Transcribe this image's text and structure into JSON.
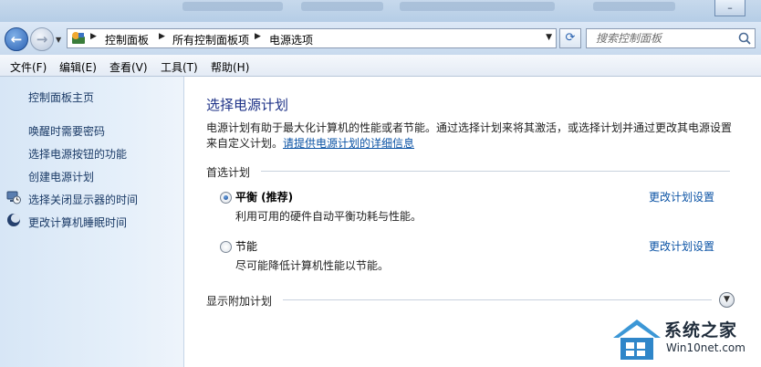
{
  "window": {
    "buttons": {
      "minimize": "–",
      "maximize": "□"
    }
  },
  "nav": {
    "breadcrumb": [
      "控制面板",
      "所有控制面板项",
      "电源选项"
    ],
    "search_placeholder": "搜索控制面板"
  },
  "menu": [
    "文件(F)",
    "编辑(E)",
    "查看(V)",
    "工具(T)",
    "帮助(H)"
  ],
  "sidebar": {
    "home": "控制面板主页",
    "links": [
      {
        "label": "唤醒时需要密码",
        "icon": ""
      },
      {
        "label": "选择电源按钮的功能",
        "icon": ""
      },
      {
        "label": "创建电源计划",
        "icon": ""
      },
      {
        "label": "选择关闭显示器的时间",
        "icon": "monitor-clock-icon"
      },
      {
        "label": "更改计算机睡眠时间",
        "icon": "moon-icon"
      }
    ]
  },
  "main": {
    "title": "选择电源计划",
    "description": "电源计划有助于最大化计算机的性能或者节能。通过选择计划来将其激活，或选择计划并通过更改其电源设置来自定义计划。",
    "description_link": "请提供电源计划的详细信息",
    "preferred_header": "首选计划",
    "plans": [
      {
        "name": "平衡 (推荐)",
        "desc": "利用可用的硬件自动平衡功耗与性能。",
        "selected": true,
        "link": "更改计划设置"
      },
      {
        "name": "节能",
        "desc": "尽可能降低计算机性能以节能。",
        "selected": false,
        "link": "更改计划设置"
      }
    ],
    "extra_header": "显示附加计划"
  },
  "watermark": {
    "cn": "系统之家",
    "en": "Win10net.com"
  },
  "colors": {
    "accent": "#1e3287",
    "link": "#0b53a5",
    "sidebar": "#dbe8f6"
  }
}
